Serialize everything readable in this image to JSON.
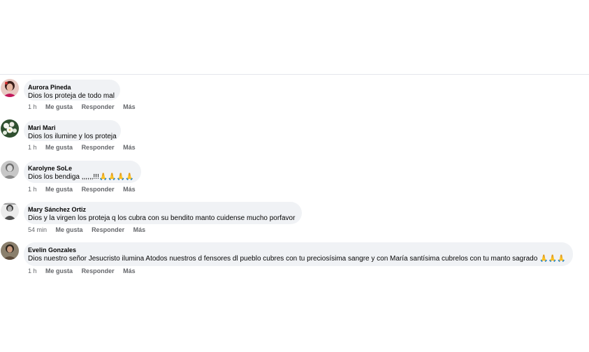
{
  "comments": [
    {
      "author": "Aurora Pineda",
      "text": "Dios los proteja de todo mal",
      "time": "1 h",
      "like": "Me gusta",
      "reply": "Responder",
      "more": "Más"
    },
    {
      "author": "Mari Mari",
      "text": "Dios los ilumine y los proteja",
      "time": "1 h",
      "like": "Me gusta",
      "reply": "Responder",
      "more": "Más"
    },
    {
      "author": "Karolyne SoLe",
      "text": "Dios los bendiga ,,,,,,!!!🙏🙏🙏🙏",
      "time": "1 h",
      "like": "Me gusta",
      "reply": "Responder",
      "more": "Más"
    },
    {
      "author": "Mary Sánchez Ortiz",
      "text": "Dios y la virgen los proteja q los cubra con su bendito manto cuidense mucho porfavor",
      "time": "54 min",
      "like": "Me gusta",
      "reply": "Responder",
      "more": "Más"
    },
    {
      "author": "Evelin Gonzales",
      "text": "Dios nuestro señor Jesucristo ilumina Atodos nuestros d fensores dl pueblo cubres con tu preciosísima sangre y con María santísima cubrelos con tu manto sagrado 🙏🙏🙏",
      "time": "1 h",
      "like": "Me gusta",
      "reply": "Responder",
      "more": "Más"
    }
  ],
  "colors": {
    "bubble": "#f0f2f5",
    "meta": "#65676b",
    "text": "#050505",
    "divider": "#e4e6eb"
  }
}
